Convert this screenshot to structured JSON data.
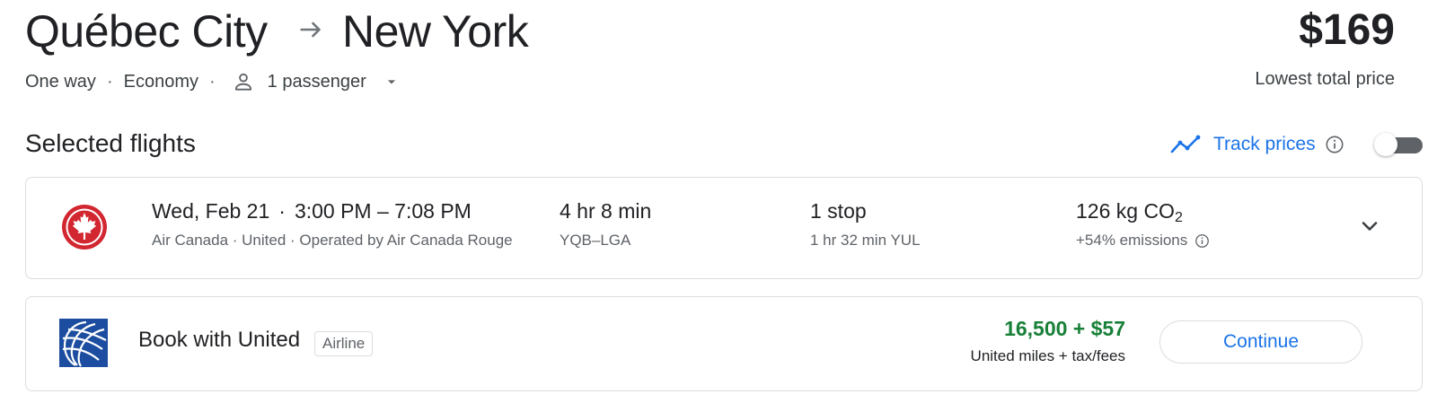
{
  "header": {
    "origin": "Québec City",
    "destination": "New York",
    "price": "$169",
    "price_caption": "Lowest total price"
  },
  "trip_options": {
    "trip_type": "One way",
    "cabin": "Economy",
    "passengers": "1 passenger"
  },
  "selected_section": {
    "title": "Selected flights",
    "track_prices_label": "Track prices",
    "track_prices_enabled": false
  },
  "flight": {
    "date": "Wed, Feb 21",
    "times": "3:00 PM – 7:08 PM",
    "airlines": "Air Canada · United · Operated by Air Canada Rouge",
    "duration": "4 hr 8 min",
    "airports": "YQB–LGA",
    "stops": "1 stop",
    "layover": "1 hr 32 min YUL",
    "emissions_value": "126 kg CO",
    "emissions_subscript": "2",
    "emissions_note": "+54% emissions"
  },
  "booking": {
    "label": "Book with United",
    "tag": "Airline",
    "miles_price": "16,500 + $57",
    "miles_caption": "United miles + tax/fees",
    "continue_label": "Continue"
  },
  "colors": {
    "accent": "#1a73e8",
    "miles_green": "#188038",
    "air_canada_red": "#d22630",
    "united_blue": "#1d4da0"
  },
  "icons": {
    "route_arrow": "arrow-right-icon",
    "passenger": "person-icon",
    "dropdown": "caret-down-icon",
    "track": "trend-line-icon",
    "info": "info-icon",
    "expand": "chevron-down-icon"
  }
}
